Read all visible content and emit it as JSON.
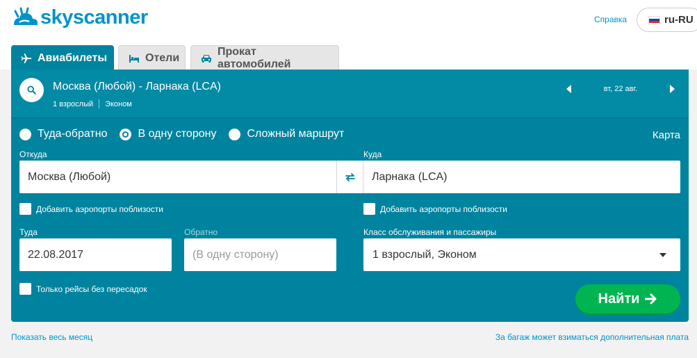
{
  "header": {
    "logo_text": "skyscanner",
    "help_link": "Справка",
    "locale": "ru-RU"
  },
  "tabs": [
    {
      "label": "Авиабилеты",
      "icon": "airplane-icon",
      "active": true
    },
    {
      "label": "Отели",
      "icon": "bed-icon",
      "active": false
    },
    {
      "label": "Прокат автомобилей",
      "icon": "car-icon",
      "active": false
    }
  ],
  "summary": {
    "route": "Москва (Любой) - Ларнака (LCA)",
    "passengers": "1 взрослый",
    "cabin": "Эконом",
    "date": "вт, 22 авг."
  },
  "trip_types": [
    {
      "label": "Туда-обратно",
      "selected": false
    },
    {
      "label": "В одну сторону",
      "selected": true
    },
    {
      "label": "Сложный маршрут",
      "selected": false
    }
  ],
  "map_link": "Карта",
  "from": {
    "label": "Откуда",
    "value": "Москва (Любой)",
    "nearby": "Добавить аэропорты поблизости"
  },
  "to": {
    "label": "Куда",
    "value": "Ларнака (LCA)",
    "nearby": "Добавить аэропорты поблизости"
  },
  "depart": {
    "label": "Туда",
    "value": "22.08.2017"
  },
  "return": {
    "label": "Обратно",
    "placeholder": "(В одну сторону)"
  },
  "cabin_class": {
    "label": "Класс обслуживания и пассажиры",
    "value": "1 взрослый, Эконом"
  },
  "direct_only": "Только рейсы без пересадок",
  "search_button": "Найти",
  "footer": {
    "whole_month": "Показать весь месяц",
    "baggage_note": "За багаж может взиматься дополнительная плата"
  },
  "colors": {
    "brand": "#0094c8",
    "panel": "#00839e",
    "search_button": "#00b551"
  }
}
